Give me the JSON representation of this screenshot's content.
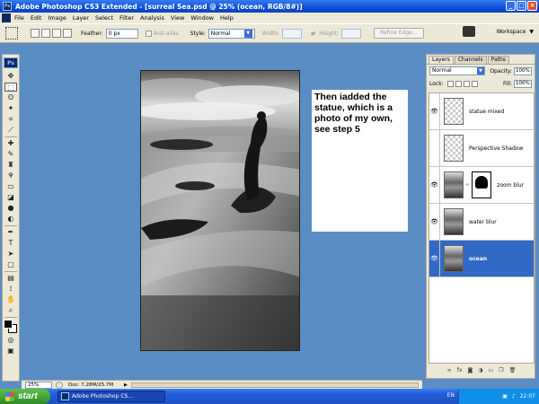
{
  "window": {
    "title": "Adobe Photoshop CS3 Extended - [surreal Sea.psd @ 25% (ocean, RGB/8#)]",
    "controls": [
      "_",
      "□",
      "×"
    ]
  },
  "menu": [
    "File",
    "Edit",
    "Image",
    "Layer",
    "Select",
    "Filter",
    "Analysis",
    "View",
    "Window",
    "Help"
  ],
  "options": {
    "feather_label": "Feather:",
    "feather_value": "0 px",
    "antialias_label": "Anti-alias",
    "style_label": "Style:",
    "style_value": "Normal",
    "width_label": "Width:",
    "height_label": "Height:",
    "refine_edge": "Refine Edge...",
    "workspace_label": "Workspace"
  },
  "note_text": "Then iadded the statue, which is a photo of my own, see step 5",
  "status": {
    "zoom": "25%",
    "doc": "Doc: 7.28M/25.7M"
  },
  "layers_panel": {
    "tabs": [
      "Layers",
      "Channels",
      "Paths"
    ],
    "blend_mode": "Normal",
    "opacity_label": "Opacity:",
    "opacity_value": "100%",
    "lock_label": "Lock:",
    "fill_label": "Fill:",
    "fill_value": "100%",
    "layers": [
      {
        "name": "statue mixed"
      },
      {
        "name": "Perspective Shadow"
      },
      {
        "name": "zoom blur"
      },
      {
        "name": "water blur"
      },
      {
        "name": "ocean"
      }
    ]
  },
  "taskbar": {
    "start": "start",
    "task": "Adobe Photoshop CS...",
    "lang": "EN",
    "clock": "22:07"
  }
}
